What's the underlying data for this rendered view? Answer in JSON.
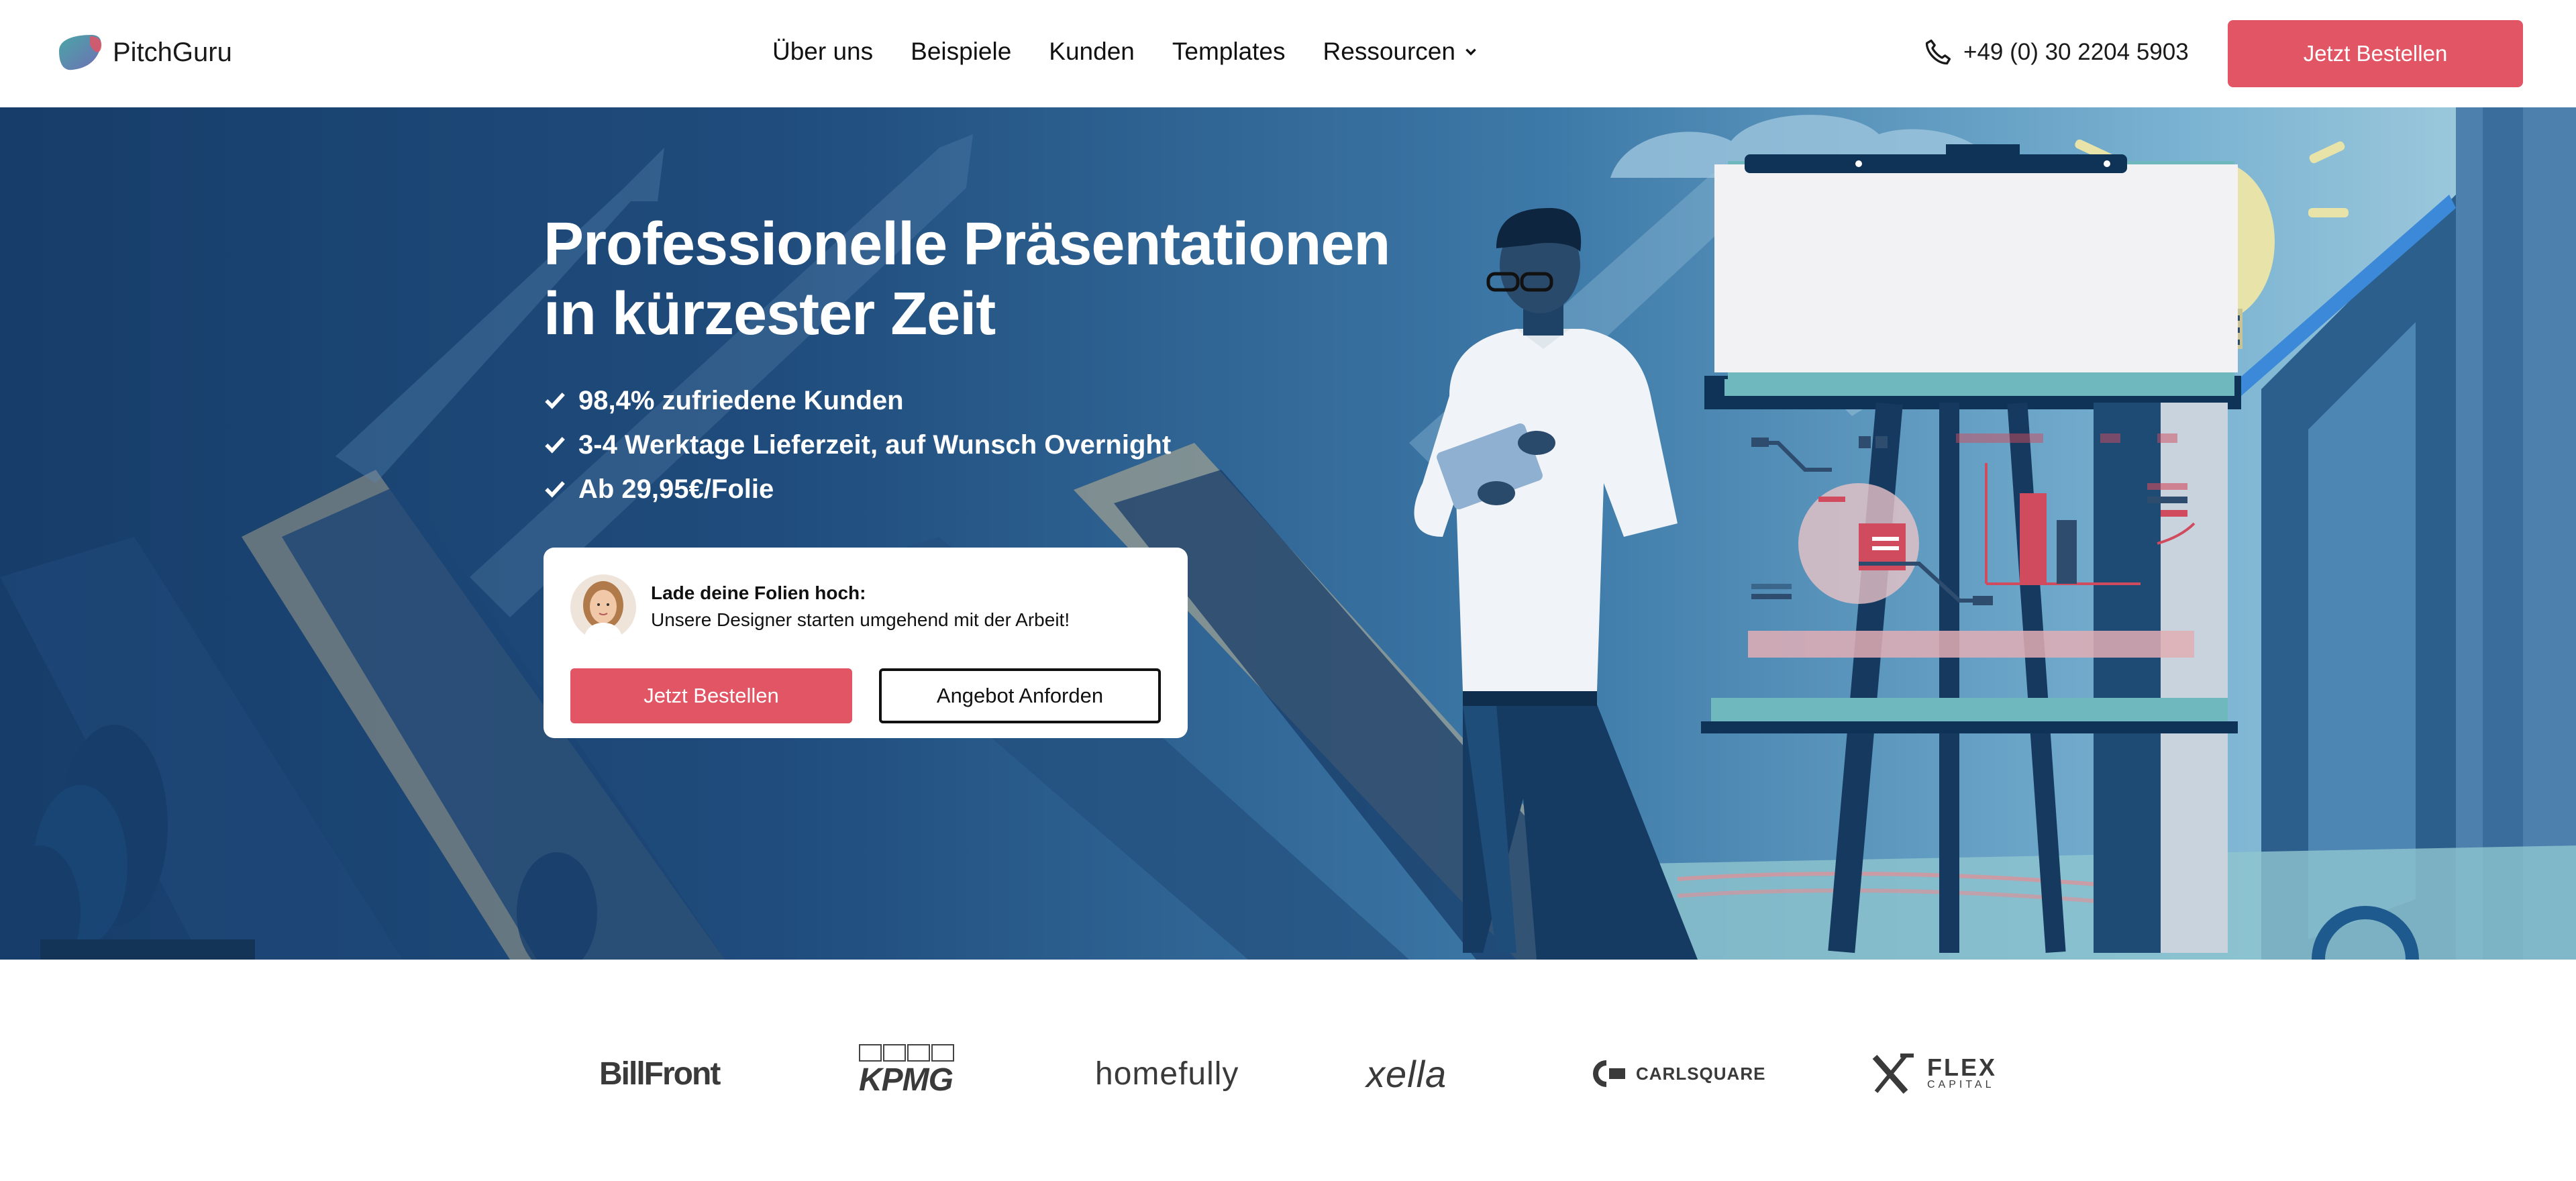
{
  "header": {
    "logo_text": "PitchGuru",
    "nav": [
      {
        "label": "Über uns"
      },
      {
        "label": "Beispiele"
      },
      {
        "label": "Kunden"
      },
      {
        "label": "Templates"
      },
      {
        "label": "Ressourcen"
      }
    ],
    "phone": "+49 (0) 30 2204 5903",
    "cta_label": "Jetzt Bestellen"
  },
  "hero": {
    "headline_line1": "Professionelle Präsentationen",
    "headline_line2": "in kürzester Zeit",
    "features": [
      {
        "text": "98,4% zufriedene Kunden"
      },
      {
        "text": "3-4 Werktage Lieferzeit, auf Wunsch Overnight"
      },
      {
        "text": "Ab 29,95€/Folie"
      }
    ],
    "card": {
      "title": "Lade deine Folien hoch:",
      "subtitle": "Unsere Designer starten umgehend mit der Arbeit!",
      "order_label": "Jetzt Bestellen",
      "offer_label": "Angebot Anforden"
    }
  },
  "clients": [
    {
      "name": "BillFront"
    },
    {
      "name": "KPMG"
    },
    {
      "name": "homefully"
    },
    {
      "name": "xella"
    },
    {
      "name": "CARLSQUARE"
    },
    {
      "name": "FLEX",
      "sub": "CAPITAL"
    }
  ],
  "colors": {
    "accent": "#e15565",
    "hero_dark": "#173d6a",
    "hero_light": "#a9d0df"
  }
}
